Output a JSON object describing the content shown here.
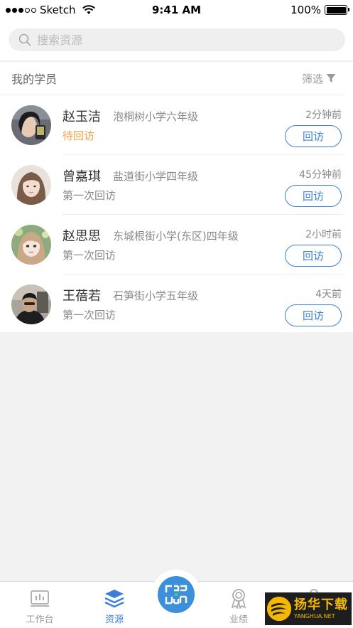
{
  "status_bar": {
    "carrier": "Sketch",
    "time": "9:41 AM",
    "battery": "100%"
  },
  "search": {
    "placeholder": "搜索资源"
  },
  "list": {
    "title": "我的学员",
    "filter_label": "筛选",
    "students": [
      {
        "name": "赵玉洁",
        "school": "泡桐树小学六年级",
        "status": "待回访",
        "time": "2分钟前",
        "action": "回访"
      },
      {
        "name": "曾嘉琪",
        "school": "盐道街小学四年级",
        "status": "第一次回访",
        "time": "45分钟前",
        "action": "回访"
      },
      {
        "name": "赵思思",
        "school": "东城根街小学(东区)四年级",
        "status": "第一次回访",
        "time": "2小时前",
        "action": "回访"
      },
      {
        "name": "王蓓若",
        "school": "石笋街小学五年级",
        "status": "第一次回访",
        "time": "4天前",
        "action": "回访"
      }
    ]
  },
  "tabbar": {
    "items": [
      {
        "label": "工作台",
        "icon": "chart-icon"
      },
      {
        "label": "资源",
        "icon": "layers-icon"
      },
      {
        "label": "",
        "icon": "scan-icon"
      },
      {
        "label": "业绩",
        "icon": "medal-icon"
      },
      {
        "label": "",
        "icon": "user-icon"
      }
    ]
  },
  "watermark": {
    "main": "扬华下载",
    "sub": "YANGHUA.NET"
  },
  "colors": {
    "accent": "#3c7fd8",
    "pending": "#f0a04a"
  }
}
